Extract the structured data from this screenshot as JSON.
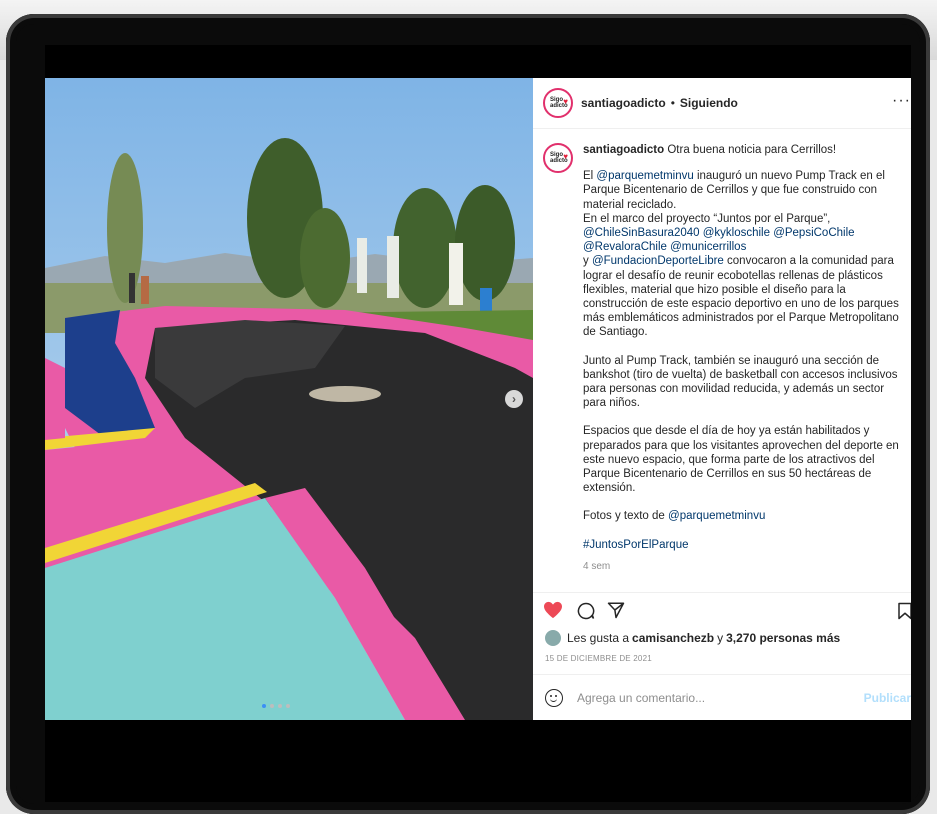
{
  "post": {
    "account": "santiagoadicto",
    "avatar_text": "Sigo adicto",
    "separator": "•",
    "follow_status": "Siguiendo",
    "more": "···",
    "caption_lead": "Otra buena noticia para Cerrillos!",
    "p1_a": "El ",
    "mention1": "@parquemetminvu",
    "p1_b": " inauguró un nuevo Pump Track en el Parque Bicentenario de Cerrillos y que fue construido con material reciclado.",
    "p2_a": "En el marco del proyecto “Juntos por el Parque”,",
    "mentions_line1": "@ChileSinBasura2040 @kykloschile @PepsiCoChile",
    "mentions_line2": "@RevaloraChile @municerrillos",
    "p2_y": "y ",
    "mention_fdl": "@FundacionDeporteLibre",
    "p2_b": " convocaron a la comunidad para lograr el desafío de reunir ecobotellas rellenas de plásticos flexibles, material que hizo posible el diseño para la construcción de este espacio deportivo en uno de los parques más emblemáticos administrados por el Parque Metropolitano de Santiago.",
    "p3": "Junto al Pump Track, también se inauguró una sección de bankshot (tiro de vuelta) de basketball con accesos inclusivos para personas con movilidad reducida, y además un sector para niños.",
    "p4": "Espacios que desde el día de hoy ya están habilitados y preparados para que los visitantes aprovechen del deporte en este nuevo espacio, que forma parte de los atractivos del Parque Bicentenario de Cerrillos en sus 50 hectáreas de extensión.",
    "p5_a": "Fotos y texto de ",
    "p5_mention": "@parquemetminvu",
    "hashtag": "#JuntosPorElParque",
    "time_ago": "4 sem",
    "likes_prefix": "Les gusta a ",
    "likes_user": "camisanchezb",
    "likes_mid": " y ",
    "likes_count": "3,270 personas más",
    "date": "15 DE DICIEMBRE DE 2021",
    "comment_placeholder": "Agrega un comentario...",
    "publish_label": "Publicar"
  },
  "colors": {
    "like_red": "#ed4956",
    "link_blue": "#00376b",
    "track_pink": "#e95aa6",
    "track_blue": "#1d3f8c",
    "track_cyan": "#7fd0cf",
    "track_yellow": "#f1d536"
  },
  "carousel": {
    "slides": 4,
    "active_index": 0
  }
}
